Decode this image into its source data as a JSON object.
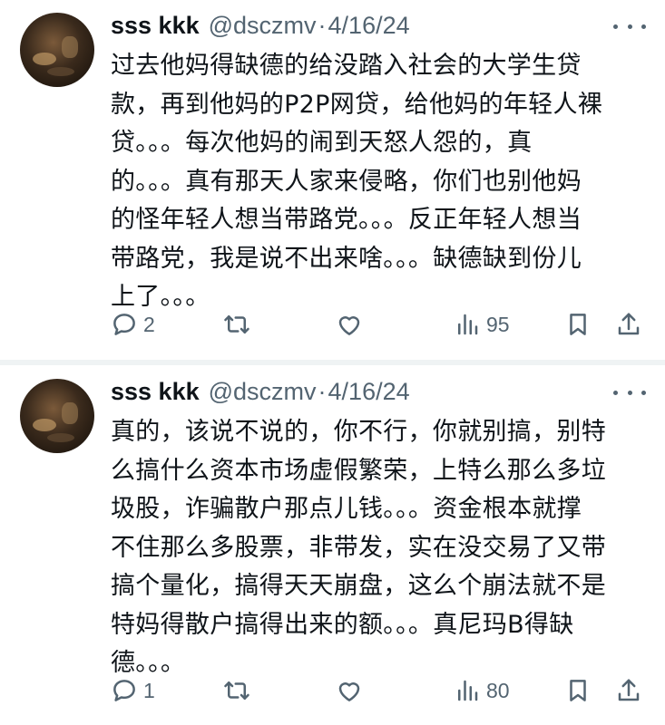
{
  "tweets": [
    {
      "name": "sss kkk",
      "handle": "@dsczmv",
      "separator": "·",
      "date": "4/16/24",
      "lines": [
        "过去他妈得缺德的给没踏入社会的大学生贷",
        "款，再到他妈的P2P网贷，给他妈的年轻人裸",
        "贷。。。每次他妈的闹到天怒人怨的，真",
        "的。。。真有那天人家来侵略，你们也别他妈",
        "的怪年轻人想当带路党。。。反正年轻人想当",
        "带路党，我是说不出来啥。。。缺德缺到份儿",
        "上了。。。"
      ],
      "replies": "2",
      "views": "95"
    },
    {
      "name": "sss kkk",
      "handle": "@dsczmv",
      "separator": "·",
      "date": "4/16/24",
      "lines": [
        "真的，该说不说的，你不行，你就别搞，别特",
        "么搞什么资本市场虚假繁荣，上特么那么多垃",
        "圾股，诈骗散户那点儿钱。。。资金根本就撑",
        "不住那么多股票，非带发，实在没交易了又带",
        "搞个量化，搞得天天崩盘，这么个崩法就不是",
        "特妈得散户搞得出来的额。。。真尼玛B得缺",
        "德。。。"
      ],
      "replies": "1",
      "views": "80"
    }
  ],
  "icons": {
    "reply": "reply-icon",
    "retweet": "retweet-icon",
    "like": "like-icon",
    "views": "views-icon",
    "bookmark": "bookmark-icon",
    "share": "share-icon",
    "more": "more-icon"
  },
  "colors": {
    "text": "#0f1419",
    "secondary": "#536471",
    "divider": "#eff3f4"
  }
}
